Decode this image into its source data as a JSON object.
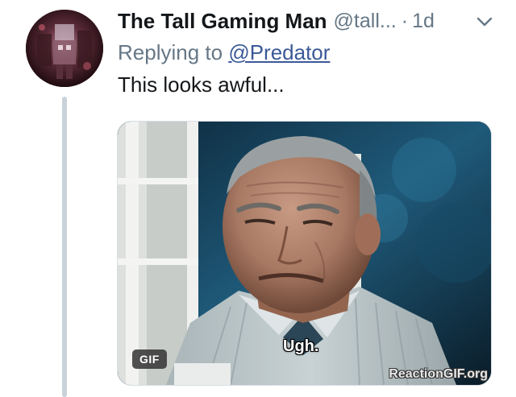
{
  "tweet": {
    "display_name": "The Tall Gaming Man",
    "handle": "@tall...",
    "separator": "·",
    "time": "1d",
    "replying_prefix": "Replying to ",
    "replying_mention": "@Predator",
    "text": "This looks awful..."
  },
  "media": {
    "gif_badge": "GIF",
    "subtitle": "Ugh.",
    "watermark": "ReactionGIF.org"
  },
  "icons": {
    "menu": "chevron-down-icon"
  },
  "colors": {
    "name": "#14171a",
    "secondary": "#657786",
    "mention": "#3b5998",
    "thread_line": "#c9d2d9"
  }
}
